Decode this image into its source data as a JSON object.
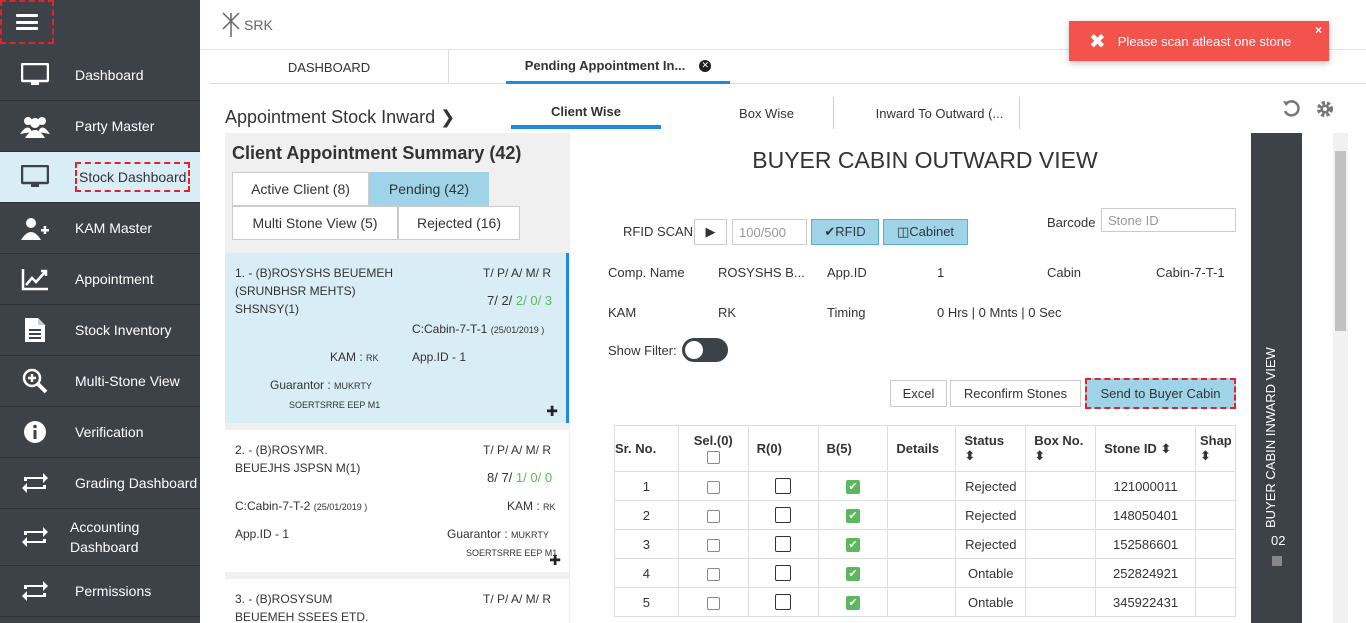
{
  "sidebar": {
    "items": [
      {
        "label": "Dashboard",
        "icon": "monitor-icon"
      },
      {
        "label": "Party Master",
        "icon": "users-icon"
      },
      {
        "label": "Stock Dashboard",
        "icon": "monitor-icon"
      },
      {
        "label": "KAM Master",
        "icon": "user-plus-icon"
      },
      {
        "label": "Appointment",
        "icon": "chart-line-icon"
      },
      {
        "label": "Stock Inventory",
        "icon": "document-icon"
      },
      {
        "label": "Multi-Stone View",
        "icon": "zoom-in-icon"
      },
      {
        "label": "Verification",
        "icon": "info-icon"
      },
      {
        "label": "Grading Dashboard",
        "icon": "transfer-icon"
      },
      {
        "label": "Accounting Dashboard",
        "icon": "transfer-icon"
      },
      {
        "label": "Permissions",
        "icon": "transfer-icon"
      }
    ]
  },
  "header": {
    "logo_text": "SRK"
  },
  "toast": {
    "message": "Please scan atleast one stone",
    "color": "#f4524d"
  },
  "tabs": [
    {
      "label": "DASHBOARD"
    },
    {
      "label": "Pending Appointment In..."
    }
  ],
  "content": {
    "title": "Appointment Stock Inward",
    "subtabs": [
      {
        "label": "Client Wise"
      },
      {
        "label": "Box Wise"
      },
      {
        "label": "Inward To Outward (..."
      }
    ]
  },
  "summary": {
    "title": "Client Appointment Summary (42)",
    "filters": [
      "Active Client (8)",
      "Pending (42)",
      "Multi Stone View (5)",
      "Rejected (16)"
    ]
  },
  "cards": [
    {
      "name": "1. - (B)ROSYSHS BEUEMEH (SRUNBHSR MEHTS) SHSNSY(1)",
      "tpam": "T/ P/ A/ M/ R",
      "c1": "7/ 2/ ",
      "c2": "2/ 0/ 3",
      "cabin": "C:Cabin-7-T-1",
      "date": "(25/01/2019 )",
      "kam_label": "KAM :",
      "kam": "RK",
      "appid": "App.ID - 1",
      "guarantor_label": "Guarantor :",
      "guarantor": "MUKRTY",
      "guarantor2": "SOERTSRRE EEP M1"
    },
    {
      "name": "2. - (B)ROSYMR. BEUEJHS JSPSN M(1)",
      "tpam": "T/ P/ A/ M/ R",
      "c1": "8/ 7/ ",
      "c2": "1/ 0/ 0",
      "cabin": "C:Cabin-7-T-2",
      "date": "(25/01/2019 )",
      "kam_label": "KAM :",
      "kam": "RK",
      "appid": "App.ID - 1",
      "guarantor_label": "Guarantor :",
      "guarantor": "MUKRTY",
      "guarantor2": "SOERTSRRE EEP M1"
    },
    {
      "name": "3. - (B)ROSYSUM BEUEMEH SSEES ETD.",
      "tpam": "T/ P/ A/ M/ R"
    }
  ],
  "main": {
    "title": "BUYER CABIN OUTWARD VIEW",
    "rfid_label": "RFID SCAN",
    "rfid_placeholder": "100/500",
    "rfid_btn": "✔RFID",
    "cabinet_btn": "◫Cabinet",
    "barcode_label": "Barcode",
    "barcode_placeholder": "Stone ID",
    "info": {
      "comp_label": "Comp. Name",
      "comp": "ROSYSHS B...",
      "appid_label": "App.ID",
      "appid": "1",
      "cabin_label": "Cabin",
      "cabin": "Cabin-7-T-1",
      "kam_label": "KAM",
      "kam": "RK",
      "timing_label": "Timing",
      "timing": "0 Hrs | 0 Mnts | 0 Sec"
    },
    "show_filter": "Show Filter:",
    "buttons": {
      "excel": "Excel",
      "reconfirm": "Reconfirm Stones",
      "send": "Send to Buyer Cabin"
    },
    "columns": [
      "Sr. No.",
      "Sel.(0)",
      "R(0)",
      "B(5)",
      "Details",
      "Status",
      "Box No.",
      "Stone ID",
      "Shap"
    ],
    "rows": [
      {
        "sr": "1",
        "status": "Rejected",
        "stone": "121000011"
      },
      {
        "sr": "2",
        "status": "Rejected",
        "stone": "148050401"
      },
      {
        "sr": "3",
        "status": "Rejected",
        "stone": "152586601"
      },
      {
        "sr": "4",
        "status": "Ontable",
        "stone": "252824921"
      },
      {
        "sr": "5",
        "status": "Ontable",
        "stone": "345922431"
      }
    ]
  },
  "rightbar": {
    "label": "BUYER CABIN INWARD VIEW",
    "count": "02"
  }
}
